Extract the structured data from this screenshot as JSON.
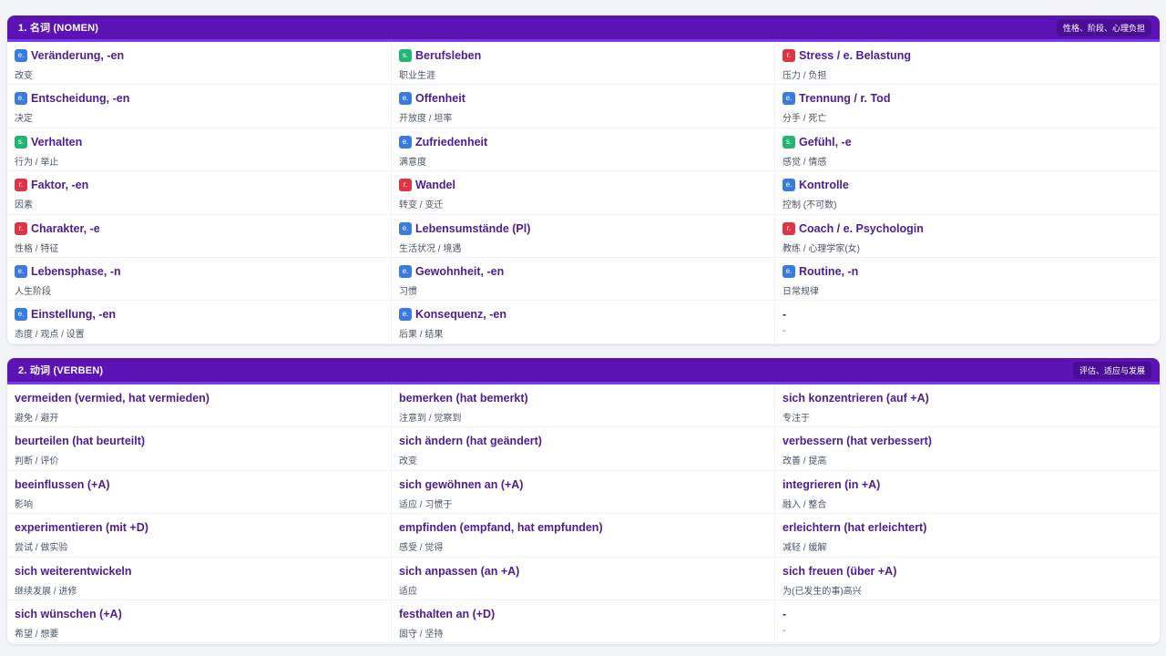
{
  "sections": [
    {
      "title": "1. 名词 (NOMEN)",
      "tag": "性格、阶段、心理负担",
      "items": [
        {
          "article": "e.",
          "term": "Veränderung, -en",
          "translation": "改变"
        },
        {
          "article": "s.",
          "term": "Berufsleben",
          "translation": "职业生涯"
        },
        {
          "article": "r.",
          "term": "Stress / e. Belastung",
          "translation": "压力 / 负担"
        },
        {
          "article": "e.",
          "term": "Entscheidung, -en",
          "translation": "决定"
        },
        {
          "article": "e.",
          "term": "Offenheit",
          "translation": "开放度 / 坦率"
        },
        {
          "article": "e.",
          "term": "Trennung / r. Tod",
          "translation": "分手 / 死亡"
        },
        {
          "article": "s.",
          "term": "Verhalten",
          "translation": "行为 / 举止"
        },
        {
          "article": "e.",
          "term": "Zufriedenheit",
          "translation": "满意度"
        },
        {
          "article": "s.",
          "term": "Gefühl, -e",
          "translation": "感觉 / 情感"
        },
        {
          "article": "r.",
          "term": "Faktor, -en",
          "translation": "因素"
        },
        {
          "article": "r.",
          "term": "Wandel",
          "translation": "转变 / 变迁"
        },
        {
          "article": "e.",
          "term": "Kontrolle",
          "translation": "控制 (不可数)"
        },
        {
          "article": "r.",
          "term": "Charakter, -e",
          "translation": "性格 / 特征"
        },
        {
          "article": "e.",
          "term": "Lebensumstände (Pl)",
          "translation": "生活状况 / 境遇"
        },
        {
          "article": "r.",
          "term": "Coach / e. Psychologin",
          "translation": "教练 / 心理学家(女)"
        },
        {
          "article": "e.",
          "term": "Lebensphase, -n",
          "translation": "人生阶段"
        },
        {
          "article": "e.",
          "term": "Gewohnheit, -en",
          "translation": "习惯"
        },
        {
          "article": "e.",
          "term": "Routine, -n",
          "translation": "日常规律"
        },
        {
          "article": "e.",
          "term": "Einstellung, -en",
          "translation": "态度 / 观点 / 设置"
        },
        {
          "article": "e.",
          "term": "Konsequenz, -en",
          "translation": "后果 / 结果"
        },
        {
          "article": "",
          "term": "-",
          "translation": "-"
        }
      ]
    },
    {
      "title": "2. 动词 (VERBEN)",
      "tag": "评估、适应与发展",
      "items": [
        {
          "article": "",
          "term": "vermeiden (vermied, hat vermieden)",
          "translation": "避免 / 避开"
        },
        {
          "article": "",
          "term": "bemerken (hat bemerkt)",
          "translation": "注意到 / 觉察到"
        },
        {
          "article": "",
          "term": "sich konzentrieren (auf +A)",
          "translation": "专注于"
        },
        {
          "article": "",
          "term": "beurteilen (hat beurteilt)",
          "translation": "判断 / 评价"
        },
        {
          "article": "",
          "term": "sich ändern (hat geändert)",
          "translation": "改变"
        },
        {
          "article": "",
          "term": "verbessern (hat verbessert)",
          "translation": "改善 / 提高"
        },
        {
          "article": "",
          "term": "beeinflussen (+A)",
          "translation": "影响"
        },
        {
          "article": "",
          "term": "sich gewöhnen an (+A)",
          "translation": "适应 / 习惯于"
        },
        {
          "article": "",
          "term": "integrieren (in +A)",
          "translation": "融入 / 整合"
        },
        {
          "article": "",
          "term": "experimentieren (mit +D)",
          "translation": "尝试 / 做实验"
        },
        {
          "article": "",
          "term": "empfinden (empfand, hat empfunden)",
          "translation": "感受 / 觉得"
        },
        {
          "article": "",
          "term": "erleichtern (hat erleichtert)",
          "translation": "减轻 / 缓解"
        },
        {
          "article": "",
          "term": "sich weiterentwickeln",
          "translation": "继续发展 / 进修"
        },
        {
          "article": "",
          "term": "sich anpassen (an +A)",
          "translation": "适应"
        },
        {
          "article": "",
          "term": "sich freuen (über +A)",
          "translation": "为(已发生的事)高兴"
        },
        {
          "article": "",
          "term": "sich wünschen (+A)",
          "translation": "希望 / 想要"
        },
        {
          "article": "",
          "term": "festhalten an (+D)",
          "translation": "固守 / 坚持"
        },
        {
          "article": "",
          "term": "-",
          "translation": "-"
        }
      ]
    }
  ]
}
